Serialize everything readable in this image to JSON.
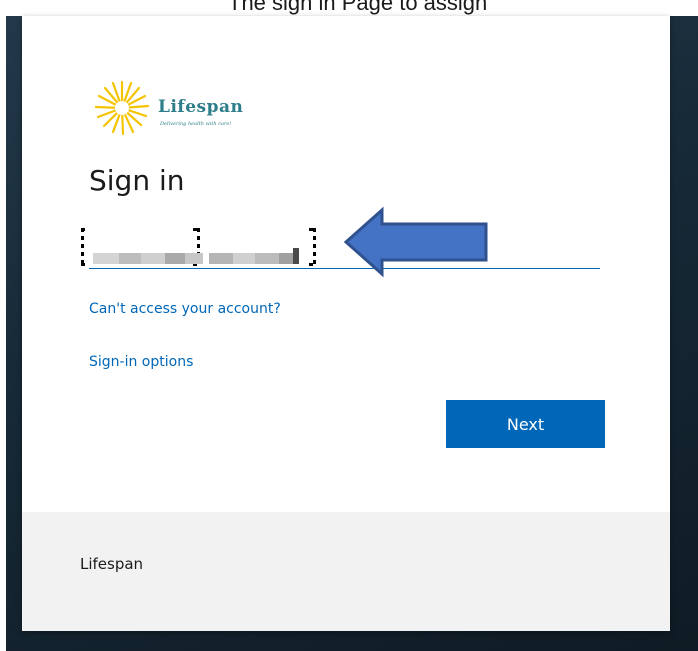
{
  "top_strip": {
    "text": "The sign in Page to assign"
  },
  "logo": {
    "name": "Lifespan",
    "tagline": "Delivering health with care!",
    "brand_color": "#2d7d8a",
    "sun_color": "#f5c400"
  },
  "signin": {
    "title": "Sign in",
    "email_value": "",
    "cant_access_link": "Can't access your account?",
    "options_link": "Sign-in options",
    "next_button": "Next"
  },
  "footer": {
    "org_name": "Lifespan"
  },
  "colors": {
    "accent": "#0067b8",
    "arrow_fill": "#4472c4",
    "arrow_stroke": "#2f528f",
    "background_dark": "#172a38",
    "footer_bg": "#f2f2f2"
  },
  "icons": {
    "annotation": "left-arrow-icon",
    "logo_mark": "sunburst-icon"
  }
}
